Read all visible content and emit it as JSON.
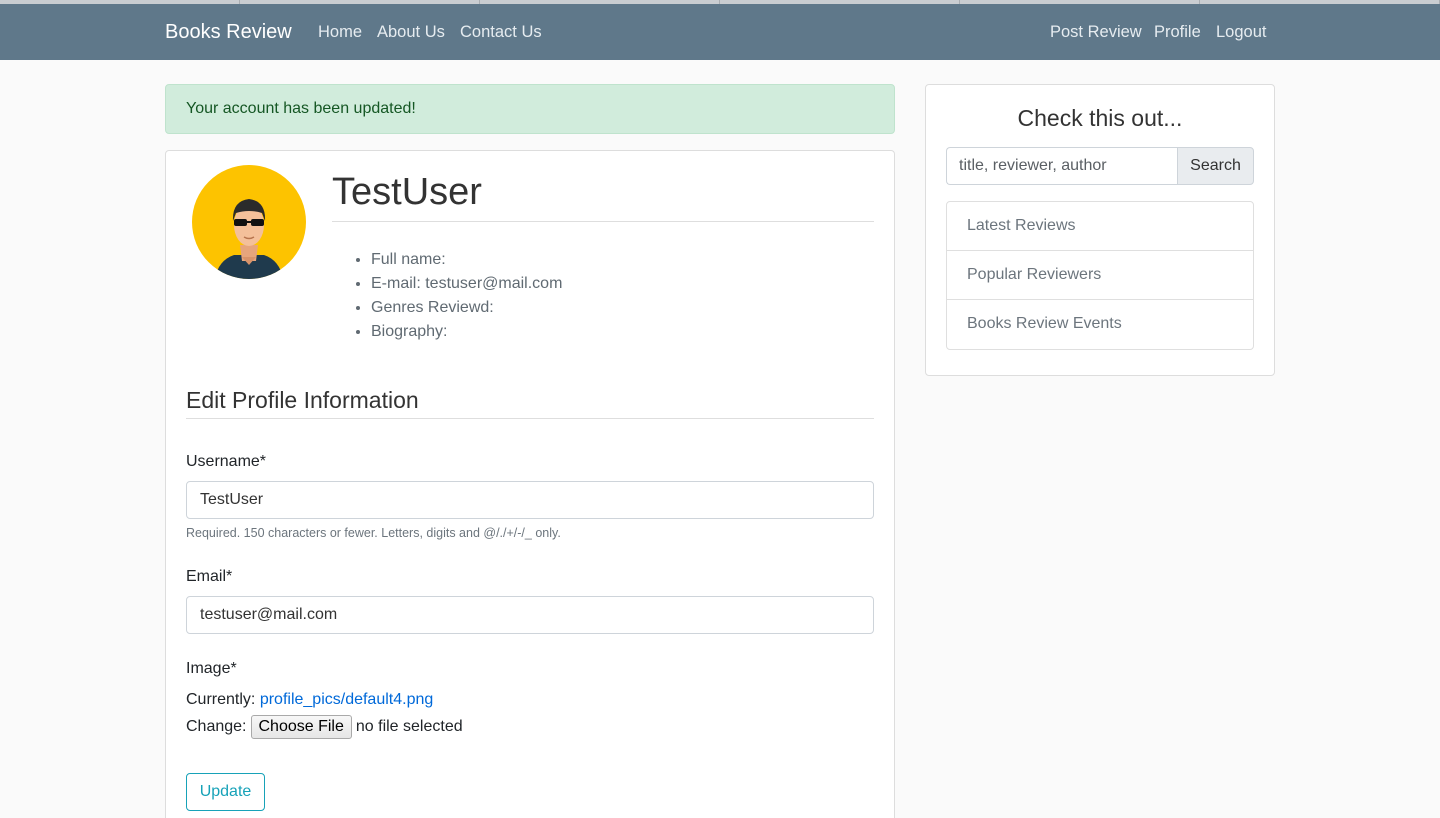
{
  "nav": {
    "brand": "Books Review",
    "left_links": [
      "Home",
      "About Us",
      "Contact Us"
    ],
    "right_links": [
      "Post Review",
      "Profile",
      "Logout"
    ]
  },
  "alert": {
    "message": "Your account has been updated!"
  },
  "profile": {
    "username": "TestUser",
    "details": [
      "Full name:",
      "E-mail: testuser@mail.com",
      "Genres Reviewd:",
      "Biography:"
    ]
  },
  "form": {
    "title": "Edit Profile Information",
    "username_label": "Username*",
    "username_value": "TestUser",
    "username_help": "Required. 150 characters or fewer. Letters, digits and @/./+/-/_ only.",
    "email_label": "Email*",
    "email_value": "testuser@mail.com",
    "image_label": "Image*",
    "currently_label": "Currently:",
    "current_file": "profile_pics/default4.png",
    "change_label": "Change:",
    "choose_file": "Choose File",
    "no_file": "no file selected",
    "update_button": "Update"
  },
  "sidebar": {
    "title": "Check this out...",
    "search_placeholder": "title, reviewer, author",
    "search_button": "Search",
    "items": [
      "Latest Reviews",
      "Popular Reviewers",
      "Books Review Events"
    ]
  },
  "colors": {
    "navbar": "#5f788a",
    "alert_bg": "#d1ecdc",
    "accent_button": "#17a2b8",
    "link": "#0069d9",
    "avatar_bg": "#fdc300"
  },
  "icons": {
    "avatar": "user-avatar-sunglasses"
  }
}
